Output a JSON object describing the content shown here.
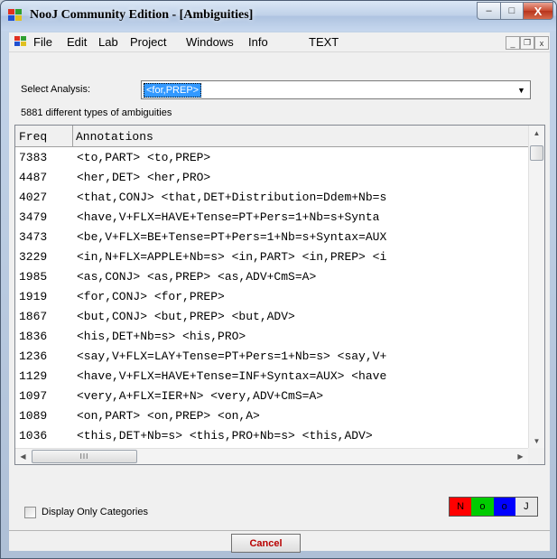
{
  "window": {
    "title": "NooJ Community Edition - [Ambiguities]",
    "min_icon": "minimize-icon",
    "max_icon": "maximize-icon",
    "close_icon": "close-icon",
    "min_glyph": "–",
    "max_glyph": "□",
    "close_glyph": "X"
  },
  "menu": {
    "items": [
      "File",
      "Edit",
      "Lab",
      "Project",
      "Windows",
      "Info",
      "TEXT"
    ],
    "mdi_min": "_",
    "mdi_restore": "❐",
    "mdi_close": "x"
  },
  "analysis": {
    "label": "Select Analysis:",
    "selected": "<for,PREP>",
    "count_text": "5881 different types of ambiguities"
  },
  "grid": {
    "headers": {
      "freq": "Freq",
      "annotations": "Annotations"
    },
    "rows": [
      {
        "freq": "7383",
        "ann": "<to,PART> <to,PREP>"
      },
      {
        "freq": "4487",
        "ann": "<her,DET> <her,PRO>"
      },
      {
        "freq": "4027",
        "ann": "<that,CONJ> <that,DET+Distribution=Ddem+Nb=s"
      },
      {
        "freq": "3479",
        "ann": "<have,V+FLX=HAVE+Tense=PT+Pers=1+Nb=s+Synta"
      },
      {
        "freq": "3473",
        "ann": "<be,V+FLX=BE+Tense=PT+Pers=1+Nb=s+Syntax=AUX"
      },
      {
        "freq": "3229",
        "ann": "<in,N+FLX=APPLE+Nb=s> <in,PART> <in,PREP> <i"
      },
      {
        "freq": "1985",
        "ann": "<as,CONJ> <as,PREP> <as,ADV+CmS=A>"
      },
      {
        "freq": "1919",
        "ann": "<for,CONJ> <for,PREP>"
      },
      {
        "freq": "1867",
        "ann": "<but,CONJ> <but,PREP> <but,ADV>"
      },
      {
        "freq": "1836",
        "ann": "<his,DET+Nb=s> <his,PRO>"
      },
      {
        "freq": "1236",
        "ann": "<say,V+FLX=LAY+Tense=PT+Pers=1+Nb=s> <say,V+"
      },
      {
        "freq": "1129",
        "ann": "<have,V+FLX=HAVE+Tense=INF+Syntax=AUX> <have"
      },
      {
        "freq": "1097",
        "ann": "<very,A+FLX=IER+N> <very,ADV+CmS=A>"
      },
      {
        "freq": "1089",
        "ann": "<on,PART> <on,PREP> <on,A>"
      },
      {
        "freq": "1036",
        "ann": "<this,DET+Nb=s> <this,PRO+Nb=s> <this,ADV>"
      }
    ],
    "hscroll_grip": "III"
  },
  "options": {
    "display_only_categories": "Display Only Categories",
    "checked": false
  },
  "color_buttons": [
    {
      "label": "N",
      "color": "#ff0000"
    },
    {
      "label": "o",
      "color": "#00cc00"
    },
    {
      "label": "o",
      "color": "#0000ff"
    },
    {
      "label": "J",
      "color": "#e8e8e8"
    }
  ],
  "footer": {
    "cancel_label": "Cancel"
  },
  "colors": {
    "selection": "#3399ff",
    "cancel_text": "#b80000"
  }
}
